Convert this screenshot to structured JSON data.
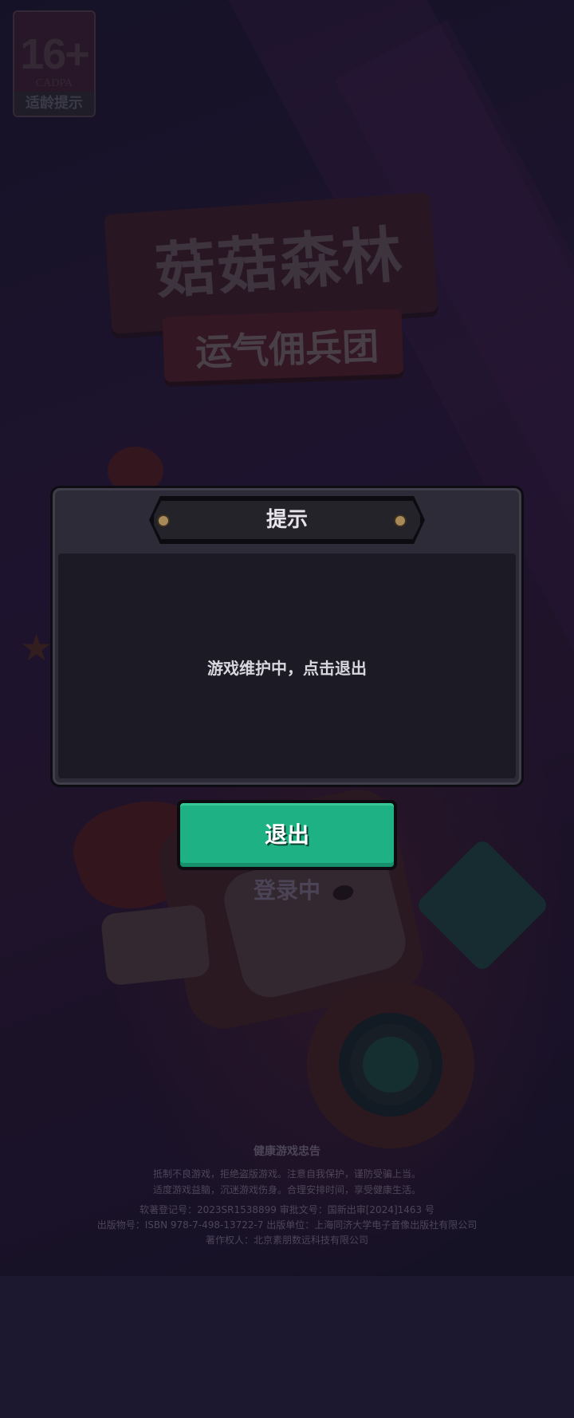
{
  "age_rating": {
    "number": "16+",
    "org": "CADPA",
    "label": "适龄提示"
  },
  "logo": {
    "title": "菇菇森林",
    "subtitle": "运气佣兵团"
  },
  "dialog": {
    "title": "提示",
    "message": "游戏维护中，点击退出"
  },
  "exit_button": {
    "label": "退出"
  },
  "login_status": "登录中",
  "footer": {
    "title": "健康游戏忠告",
    "lines": [
      "抵制不良游戏，拒绝盗版游戏。注意自我保护，谨防受骗上当。",
      "适度游戏益脑，沉迷游戏伤身。合理安排时间，享受健康生活。",
      "软著登记号：2023SR1538899 审批文号：国新出审[2024]1463 号",
      "出版物号：ISBN 978-7-498-13722-7 出版单位：上海同济大学电子音像出版社有限公司",
      "著作权人：北京素朋数远科技有限公司"
    ]
  },
  "colors": {
    "button_green": "#1db183",
    "dialog_bg": "#2d2b38",
    "rivet_gold": "#a88a58"
  }
}
